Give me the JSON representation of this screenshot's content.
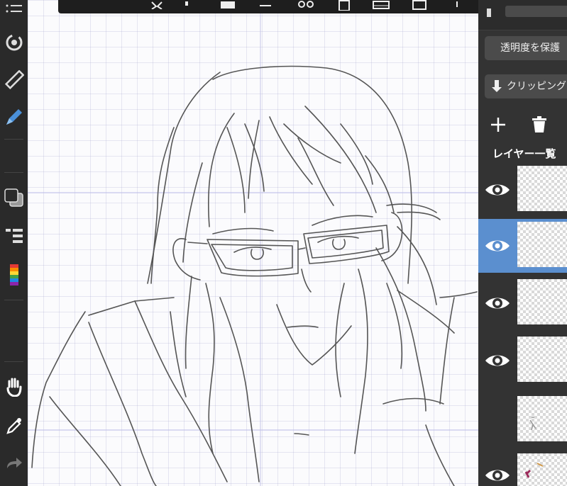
{
  "app": {
    "left_toolbar": {
      "icons": [
        "menu-icon",
        "transform-rotate-icon",
        "ruler-icon",
        "pen-icon",
        "color-swatch-icon",
        "layer-list-icon",
        "color-palette-icon",
        "hand-icon",
        "eyedropper-icon",
        "redo-icon"
      ],
      "colors": {
        "foreground": "#2b2b2b",
        "background": "#9a9a9a",
        "accent": "#4a90d9"
      }
    },
    "top_toolbar": {
      "icons": [
        "transform-icon",
        "dot-icon",
        "fill-icon",
        "rect-select-icon",
        "cut-icon",
        "copy-icon",
        "grid-icon",
        "frame-icon",
        "plus-icon",
        "lasso-icon",
        "window-icon"
      ]
    },
    "layer_panel": {
      "protect_alpha_label": "透明度を保護",
      "clipping_label": "クリッピング",
      "add_layer_icon": "plus-icon",
      "delete_layer_icon": "trash-icon",
      "heading": "レイヤー一覧",
      "selected_color": "#5b8fcf",
      "layers": [
        {
          "visible": true,
          "selected": false
        },
        {
          "visible": true,
          "selected": true
        },
        {
          "visible": true,
          "selected": false
        },
        {
          "visible": true,
          "selected": false
        },
        {
          "visible": false,
          "selected": false
        },
        {
          "visible": true,
          "selected": false
        }
      ]
    },
    "canvas": {
      "content": "line-art-sketch",
      "guide_color": "#b9b9e6"
    }
  }
}
